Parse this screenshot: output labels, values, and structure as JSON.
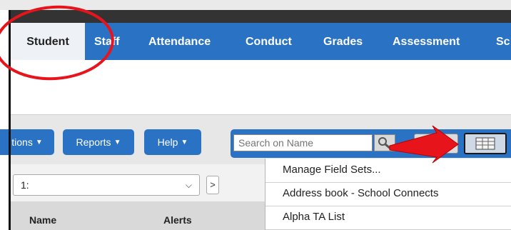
{
  "nav": {
    "tabs": [
      {
        "label": "Student",
        "active": true
      },
      {
        "label": "Staff",
        "active": false
      },
      {
        "label": "Attendance",
        "active": false
      },
      {
        "label": "Conduct",
        "active": false
      },
      {
        "label": "Grades",
        "active": false
      },
      {
        "label": "Assessment",
        "active": false
      },
      {
        "label": "Sc",
        "active": false
      }
    ]
  },
  "toolbar": {
    "options_label": "tions",
    "reports_label": "Reports",
    "help_label": "Help",
    "search_placeholder": "Search on Name",
    "search_icon": "magnifier-icon",
    "view_icon": "grid-icon"
  },
  "list": {
    "selected_option": "1:",
    "next_label": ">",
    "columns": [
      "Name",
      "Alerts"
    ]
  },
  "menu": {
    "items": [
      "Manage Field Sets...",
      "Address book - School Connects",
      "Alpha TA List"
    ]
  },
  "colors": {
    "nav_blue": "#2a72c4",
    "annotation_red": "#e8141b"
  }
}
